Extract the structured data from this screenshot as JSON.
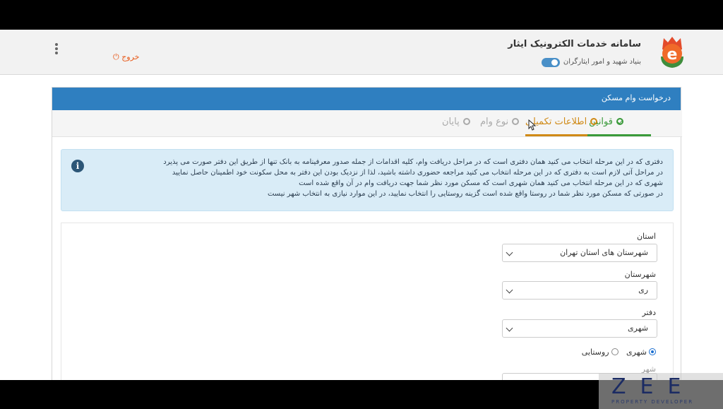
{
  "header": {
    "title": "سامانه خدمات الکترونیک ایثار",
    "subtitle": "بنیاد شهید و امور ایثارگران",
    "logout_label": "خروج",
    "logout_icon": "power-icon",
    "menu_icon": "kebab-menu-icon"
  },
  "card": {
    "title": "درخواست وام مسکن"
  },
  "steps": [
    {
      "label": "قوانین",
      "state": "done"
    },
    {
      "label": "اطلاعات تکمیلی",
      "state": "active"
    },
    {
      "label": "نوع وام",
      "state": "todo"
    },
    {
      "label": "پایان",
      "state": "todo"
    }
  ],
  "alert": {
    "icon": "info-icon",
    "lines": [
      "دفتری که در این مرحله انتخاب می کنید همان دفتری است که در مراحل دریافت وام، کلیه اقدامات از جمله صدور معرفینامه به بانک تنها از طریق این دفتر صورت می پذیرد",
      "در مراحل آتی لازم است به دفتری که در این مرحله انتخاب می کنید مراجعه حضوری داشته باشید، لذا از نزدیک بودن این دفتر به محل سکونت خود اطمینان حاصل نمایید",
      "شهری که در این مرحله انتخاب می کنید همان شهری است که مسکن مورد نظر شما جهت دریافت وام در آن واقع شده است",
      "در صورتی که مسکن مورد نظر شما در روستا واقع شده است گزینه روستایی را انتخاب نمایید، در این موارد نیازی به انتخاب شهر نیست"
    ]
  },
  "form": {
    "province_label": "استان",
    "province_value": "شهرستان های استان تهران",
    "county_label": "شهرستان",
    "county_value": "ری",
    "office_label": "دفتر",
    "office_value": "شهری",
    "area_options": [
      {
        "label": "شهری",
        "selected": true
      },
      {
        "label": "روستایی",
        "selected": false
      }
    ],
    "city_label": "شهر"
  },
  "watermark": {
    "main": "ZEE",
    "sub": "PROPERTY DEVELOPER"
  },
  "colors": {
    "card_header": "#2f7fc0",
    "step_done": "#3a9a3a",
    "step_active": "#d08a16",
    "logout": "#e85a1a",
    "alert_bg": "#d9ecf7"
  }
}
